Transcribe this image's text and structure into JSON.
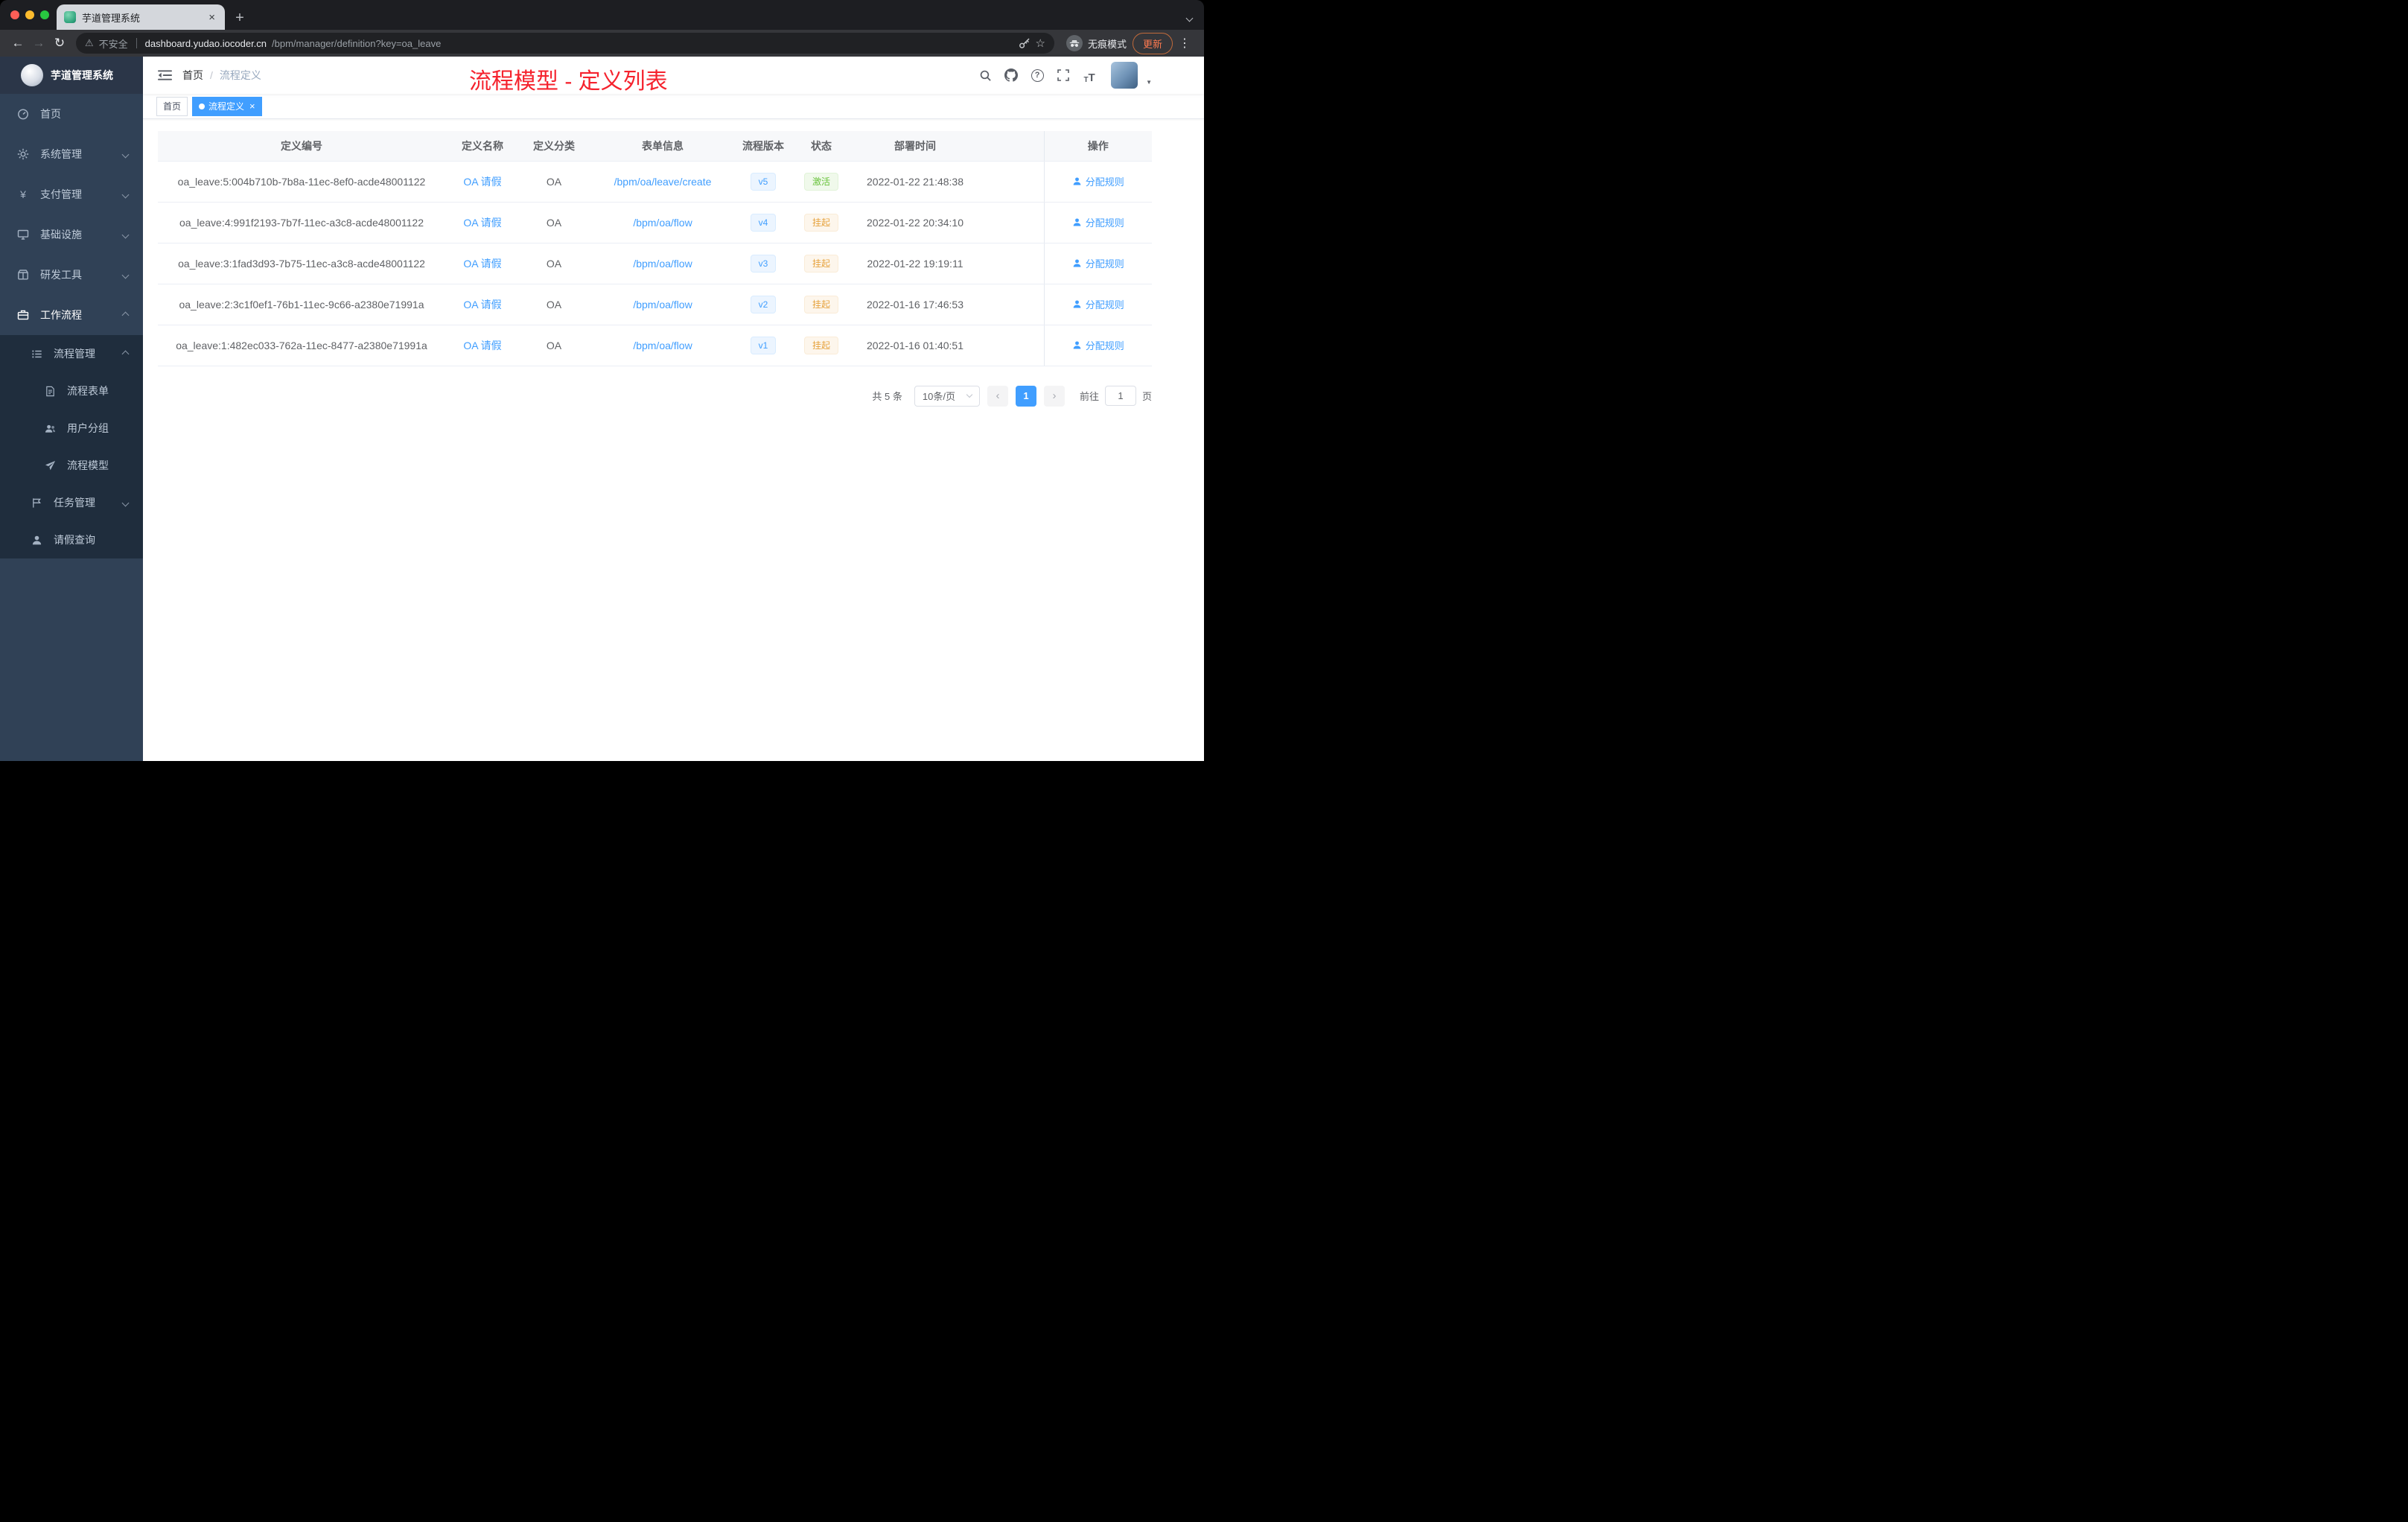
{
  "browser": {
    "tab_title": "芋道管理系统",
    "security_label": "不安全",
    "url_host": "dashboard.yudao.iocoder.cn",
    "url_path": "/bpm/manager/definition?key=oa_leave",
    "incognito_label": "无痕模式",
    "update_label": "更新"
  },
  "sidebar": {
    "logo_title": "芋道管理系统",
    "items": [
      {
        "label": "首页",
        "icon": "home-icon"
      },
      {
        "label": "系统管理",
        "icon": "gear-icon"
      },
      {
        "label": "支付管理",
        "icon": "yen-icon"
      },
      {
        "label": "基础设施",
        "icon": "monitor-icon"
      },
      {
        "label": "研发工具",
        "icon": "toolbox-icon"
      },
      {
        "label": "工作流程",
        "icon": "briefcase-icon",
        "expanded": true
      }
    ],
    "workflow": {
      "process_mgmt": {
        "label": "流程管理",
        "expanded": true,
        "children": [
          {
            "label": "流程表单",
            "icon": "document-icon"
          },
          {
            "label": "用户分组",
            "icon": "users-icon"
          },
          {
            "label": "流程模型",
            "icon": "paper-plane-icon"
          }
        ]
      },
      "task_mgmt": {
        "label": "任务管理",
        "icon": "flag-icon"
      },
      "leave_query": {
        "label": "请假查询",
        "icon": "person-icon"
      }
    }
  },
  "navbar": {
    "breadcrumb": [
      "首页",
      "流程定义"
    ],
    "annotation": "流程模型 - 定义列表"
  },
  "tags": {
    "home": "首页",
    "active": "流程定义"
  },
  "table": {
    "columns": [
      "定义编号",
      "定义名称",
      "定义分类",
      "表单信息",
      "流程版本",
      "状态",
      "部署时间",
      "操作"
    ],
    "rows": [
      {
        "id": "oa_leave:5:004b710b-7b8a-11ec-8ef0-acde48001122",
        "name": "OA 请假",
        "category": "OA",
        "form": "/bpm/oa/leave/create",
        "version": "v5",
        "status": "激活",
        "status_type": "success",
        "time": "2022-01-22 21:48:38",
        "action": "分配规则"
      },
      {
        "id": "oa_leave:4:991f2193-7b7f-11ec-a3c8-acde48001122",
        "name": "OA 请假",
        "category": "OA",
        "form": "/bpm/oa/flow",
        "version": "v4",
        "status": "挂起",
        "status_type": "warning",
        "time": "2022-01-22 20:34:10",
        "action": "分配规则"
      },
      {
        "id": "oa_leave:3:1fad3d93-7b75-11ec-a3c8-acde48001122",
        "name": "OA 请假",
        "category": "OA",
        "form": "/bpm/oa/flow",
        "version": "v3",
        "status": "挂起",
        "status_type": "warning",
        "time": "2022-01-22 19:19:11",
        "action": "分配规则"
      },
      {
        "id": "oa_leave:2:3c1f0ef1-76b1-11ec-9c66-a2380e71991a",
        "name": "OA 请假",
        "category": "OA",
        "form": "/bpm/oa/flow",
        "version": "v2",
        "status": "挂起",
        "status_type": "warning",
        "time": "2022-01-16 17:46:53",
        "action": "分配规则"
      },
      {
        "id": "oa_leave:1:482ec033-762a-11ec-8477-a2380e71991a",
        "name": "OA 请假",
        "category": "OA",
        "form": "/bpm/oa/flow",
        "version": "v1",
        "status": "挂起",
        "status_type": "warning",
        "time": "2022-01-16 01:40:51",
        "action": "分配规则"
      }
    ]
  },
  "pagination": {
    "total": "共 5 条",
    "page_size": "10条/页",
    "current": "1",
    "goto_label": "前往",
    "goto_value": "1",
    "goto_unit": "页"
  },
  "colors": {
    "accent": "#409eff",
    "success": "#67c23a",
    "warning": "#e6a23c",
    "annotation_red": "#f5222d",
    "sidebar_bg": "#304156",
    "submenu_bg": "#1f2d3d"
  },
  "icons": {
    "traffic_lights": "red/yellow/green circles",
    "search": "magnifier",
    "github": "github-mark",
    "help": "question-circle",
    "fullscreen": "expand-corners",
    "font_size": "TT",
    "incognito": "hat-and-glasses",
    "assign_rule": "person",
    "warning": "⚠",
    "close": "×"
  }
}
